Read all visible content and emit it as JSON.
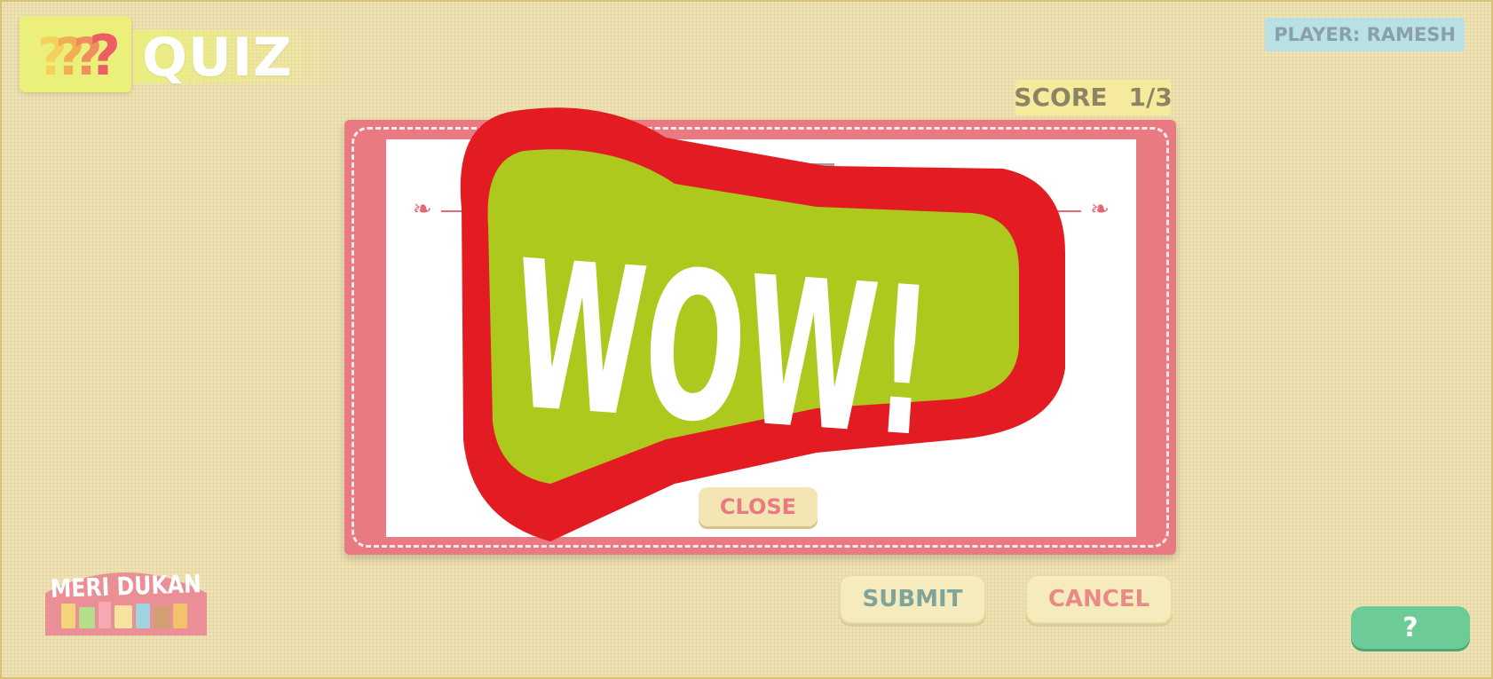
{
  "header": {
    "title": "QUIZ",
    "player": "PLAYER: RAMESH",
    "score_label": "SCORE",
    "score_value": "1/3"
  },
  "result": {
    "title": "RESULT",
    "close_label": "CLOSE"
  },
  "overlay": {
    "text": "WOW!"
  },
  "actions": {
    "submit_label": "SUBMIT",
    "cancel_label": "CANCEL",
    "help_label": "?"
  },
  "logo": {
    "text": "MERI DUKAN"
  },
  "colors": {
    "background": "#efe2b4",
    "card_pink": "#ea7a82",
    "wow_red": "#e31c23",
    "wow_green": "#aec91e",
    "help_green": "#6ccb97",
    "player_badge": "#b9e0e4",
    "score_yellow": "#f6ea9c"
  }
}
